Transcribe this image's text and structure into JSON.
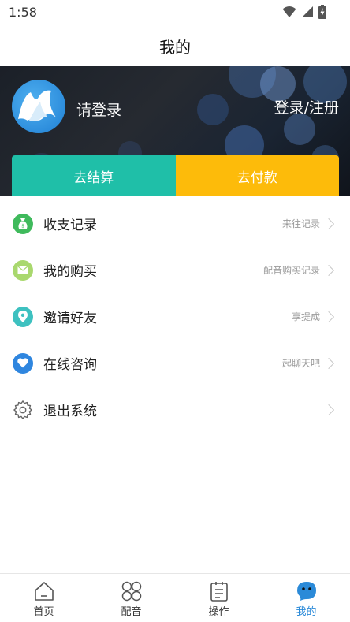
{
  "status_bar": {
    "time": "1:58"
  },
  "header": {
    "title": "我的"
  },
  "profile": {
    "login_prompt": "请登录",
    "login_register": "登录/注册"
  },
  "actions": {
    "settle_label": "去结算",
    "pay_label": "去付款"
  },
  "menu": {
    "items": [
      {
        "label": "收支记录",
        "hint": "来往记录",
        "icon": "money-bag-icon",
        "color": "#3fba5c"
      },
      {
        "label": "我的购买",
        "hint": "配音购买记录",
        "icon": "mail-icon",
        "color": "#a9d86e"
      },
      {
        "label": "邀请好友",
        "hint": "享提成",
        "icon": "location-pin-icon",
        "color": "#3ec1c0"
      },
      {
        "label": "在线咨询",
        "hint": "一起聊天吧",
        "icon": "heart-icon",
        "color": "#2f86df"
      },
      {
        "label": "退出系统",
        "hint": "",
        "icon": "gear-icon",
        "color": "#666666"
      }
    ]
  },
  "tab_bar": {
    "tabs": [
      {
        "label": "首页",
        "icon": "home-icon"
      },
      {
        "label": "配音",
        "icon": "grid-icon"
      },
      {
        "label": "操作",
        "icon": "clipboard-icon"
      },
      {
        "label": "我的",
        "icon": "chat-bubble-icon",
        "active": true
      }
    ]
  },
  "colors": {
    "accent_teal": "#1fbfa8",
    "accent_yellow": "#fdbb0a",
    "active_tab": "#2b8ad8"
  }
}
